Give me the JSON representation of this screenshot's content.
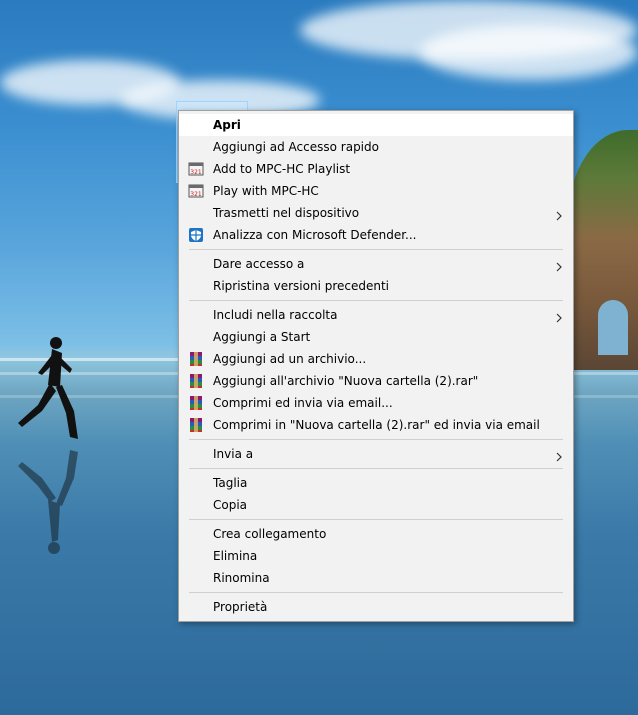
{
  "context_menu": {
    "groups": [
      [
        {
          "label": "Apri",
          "icon": "",
          "default": true
        },
        {
          "label": "Aggiungi ad Accesso rapido",
          "icon": ""
        },
        {
          "label": "Add to MPC-HC Playlist",
          "icon": "mpc-hc-icon"
        },
        {
          "label": "Play with MPC-HC",
          "icon": "mpc-hc-icon"
        },
        {
          "label": "Trasmetti nel dispositivo",
          "icon": "",
          "submenu": true
        },
        {
          "label": "Analizza con Microsoft Defender...",
          "icon": "defender-shield-icon"
        }
      ],
      [
        {
          "label": "Dare accesso a",
          "icon": "",
          "submenu": true
        },
        {
          "label": "Ripristina versioni precedenti",
          "icon": ""
        }
      ],
      [
        {
          "label": "Includi nella raccolta",
          "icon": "",
          "submenu": true
        },
        {
          "label": "Aggiungi a Start",
          "icon": ""
        },
        {
          "label": "Aggiungi ad un archivio...",
          "icon": "winrar-icon"
        },
        {
          "label": "Aggiungi all'archivio \"Nuova cartella (2).rar\"",
          "icon": "winrar-icon"
        },
        {
          "label": "Comprimi ed invia via email...",
          "icon": "winrar-icon"
        },
        {
          "label": "Comprimi in \"Nuova cartella (2).rar\" ed invia via email",
          "icon": "winrar-icon"
        }
      ],
      [
        {
          "label": "Invia a",
          "icon": "",
          "submenu": true
        }
      ],
      [
        {
          "label": "Taglia",
          "icon": ""
        },
        {
          "label": "Copia",
          "icon": ""
        }
      ],
      [
        {
          "label": "Crea collegamento",
          "icon": ""
        },
        {
          "label": "Elimina",
          "icon": ""
        },
        {
          "label": "Rinomina",
          "icon": ""
        }
      ],
      [
        {
          "label": "Proprietà",
          "icon": ""
        }
      ]
    ]
  },
  "colors": {
    "menu_bg": "#f2f2f2",
    "highlight": "#ffffff",
    "separator": "#cfcfcf",
    "defender_blue": "#1e73c8"
  }
}
